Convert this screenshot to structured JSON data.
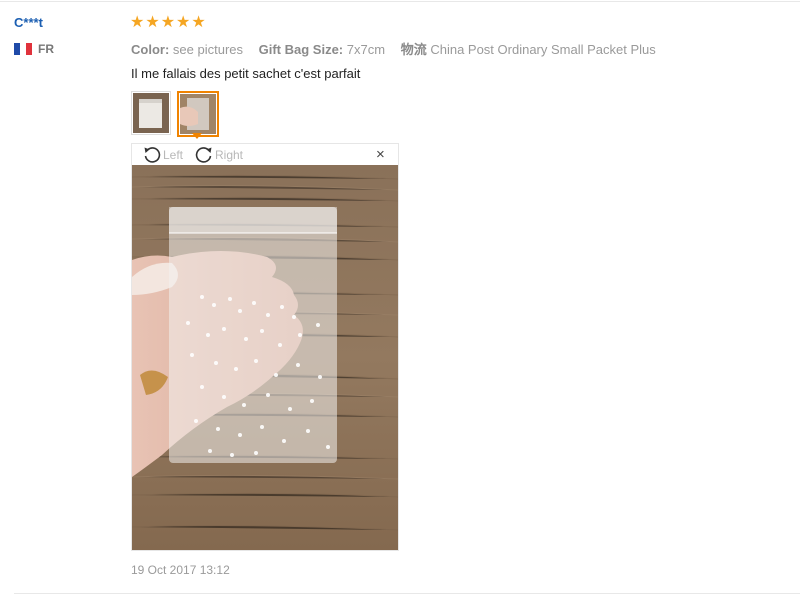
{
  "review": {
    "user_name": "C***t",
    "country_code": "FR",
    "rating": 5,
    "attributes": [
      {
        "key": "Color:",
        "value": "see pictures"
      },
      {
        "key": "Gift Bag Size:",
        "value": "7x7cm"
      },
      {
        "key": "物流",
        "value": "China Post Ordinary Small Packet Plus"
      }
    ],
    "text": "Il me fallais des petit sachet c'est parfait",
    "date": "19 Oct 2017 13:12"
  },
  "viewer": {
    "rotate_left_label": "Left",
    "rotate_right_label": "Right",
    "close_label": "×"
  },
  "colors": {
    "username": "#1c5fb2",
    "star": "#f5a623",
    "active_thumb": "#f08300"
  }
}
